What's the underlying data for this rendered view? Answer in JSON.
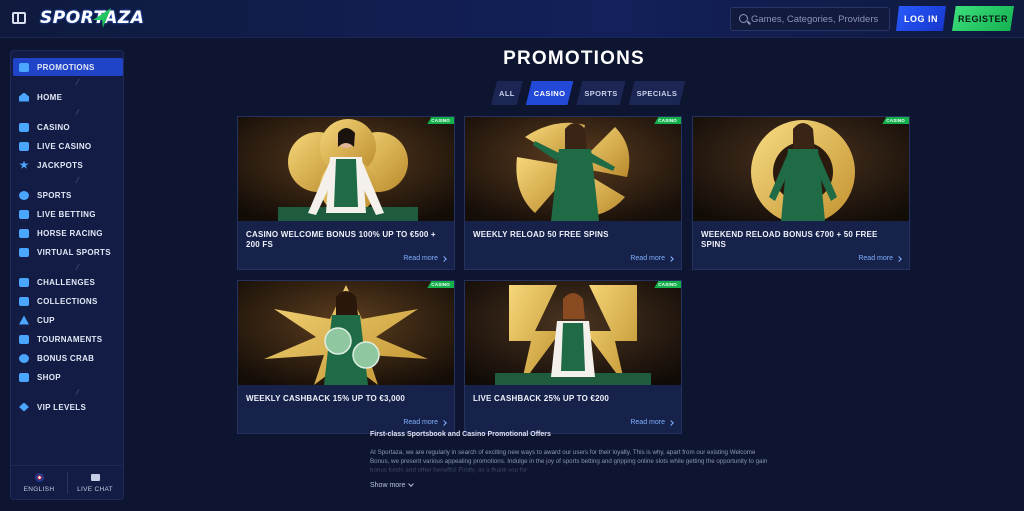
{
  "header": {
    "logo_text": "SPORTAZA",
    "search_placeholder": "Games, Categories, Providers",
    "login_label": "LOG IN",
    "register_label": "REGISTER"
  },
  "sidebar": {
    "items": [
      {
        "label": "PROMOTIONS",
        "icon": "gift-icon",
        "active": true
      },
      {
        "label": "HOME",
        "icon": "home-icon"
      },
      {
        "label": "CASINO",
        "icon": "casino-icon"
      },
      {
        "label": "LIVE CASINO",
        "icon": "live-casino-icon"
      },
      {
        "label": "JACKPOTS",
        "icon": "jackpot-icon"
      },
      {
        "label": "SPORTS",
        "icon": "soccer-ball-icon"
      },
      {
        "label": "LIVE BETTING",
        "icon": "live-betting-icon"
      },
      {
        "label": "HORSE RACING",
        "icon": "horse-icon"
      },
      {
        "label": "VIRTUAL SPORTS",
        "icon": "virtual-sports-icon"
      },
      {
        "label": "CHALLENGES",
        "icon": "challenges-icon"
      },
      {
        "label": "COLLECTIONS",
        "icon": "collections-icon"
      },
      {
        "label": "CUP",
        "icon": "cup-icon"
      },
      {
        "label": "TOURNAMENTS",
        "icon": "tournaments-icon"
      },
      {
        "label": "BONUS CRAB",
        "icon": "crab-icon"
      },
      {
        "label": "SHOP",
        "icon": "shop-icon"
      },
      {
        "label": "VIP LEVELS",
        "icon": "diamond-icon"
      }
    ],
    "footer": {
      "language": "ENGLISH",
      "chat": "LIVE CHAT"
    }
  },
  "main": {
    "title": "PROMOTIONS",
    "tabs": [
      {
        "label": "ALL",
        "active": false
      },
      {
        "label": "CASINO",
        "active": true
      },
      {
        "label": "SPORTS",
        "active": false
      },
      {
        "label": "SPECIALS",
        "active": false
      }
    ],
    "cards": [
      {
        "title": "CASINO WELCOME BONUS 100% UP TO €500 + 200 FS",
        "badge": "CASINO",
        "link": "Read more",
        "art": "clover"
      },
      {
        "title": "WEEKLY RELOAD 50 FREE SPINS",
        "badge": "CASINO",
        "link": "Read more",
        "art": "spiral"
      },
      {
        "title": "WEEKEND RELOAD BONUS €700 + 50 FREE SPINS",
        "badge": "CASINO",
        "link": "Read more",
        "art": "ring"
      },
      {
        "title": "WEEKLY CASHBACK 15% UP TO €3,000",
        "badge": "CASINO",
        "link": "Read more",
        "art": "burst"
      },
      {
        "title": "LIVE CASHBACK 25% UP TO €200",
        "badge": "CASINO",
        "link": "Read more",
        "art": "bolt"
      }
    ],
    "info": {
      "title": "First-class Sportsbook and Casino Promotional Offers",
      "text": "At Sportaza, we are regularly in search of exciting new ways to award our users for their loyalty. This is why, apart from our existing Welcome Bonus, we present various appealing promotions. Indulge in the joy of sports betting and gripping online slots while getting the opportunity to gain bonus funds and other benefits! Firstly, as a thank you for",
      "show_more": "Show more"
    }
  },
  "colors": {
    "accent_blue": "#2249d8",
    "accent_green": "#14b04b",
    "gold": "#e2b551",
    "dress_green": "#1f6b46"
  }
}
